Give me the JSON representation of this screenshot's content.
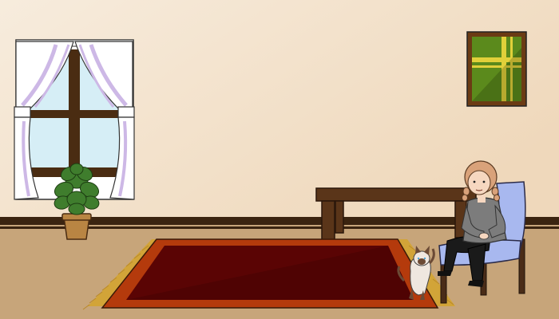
{
  "scene": {
    "palette": {
      "wall_light": "#f7ecdd",
      "wall_dark": "#efd8bb",
      "floor": "#c7a57a",
      "baseboard": "#3b2410",
      "window_frame": "#4a2c12",
      "glass": "#d6eef6",
      "curtain": "#ffffff",
      "curtain_shade": "#cdb8e6",
      "plant_leaf": "#3f7d2d",
      "pot": "#b98543",
      "painting_frame": "#6b3b14",
      "painting_green": "#5b8a1c",
      "painting_yellow": "#e1d03a",
      "table": "#5a3519",
      "rug_outer": "#b43a0c",
      "rug_inner": "#5a0404",
      "rug_fringe": "#d2a438",
      "chair": "#a8b8ef",
      "chair_legs": "#4a2c18",
      "hair": "#d9a27a",
      "skin": "#f6d7c0",
      "sweater": "#7c7c7c",
      "pants": "#1a1a1a",
      "cat_body": "#efe7df",
      "cat_points": "#6b4a35"
    },
    "icons": [
      "window",
      "curtains",
      "potted-plant",
      "painting",
      "table",
      "rug",
      "chair",
      "girl",
      "cat"
    ]
  }
}
